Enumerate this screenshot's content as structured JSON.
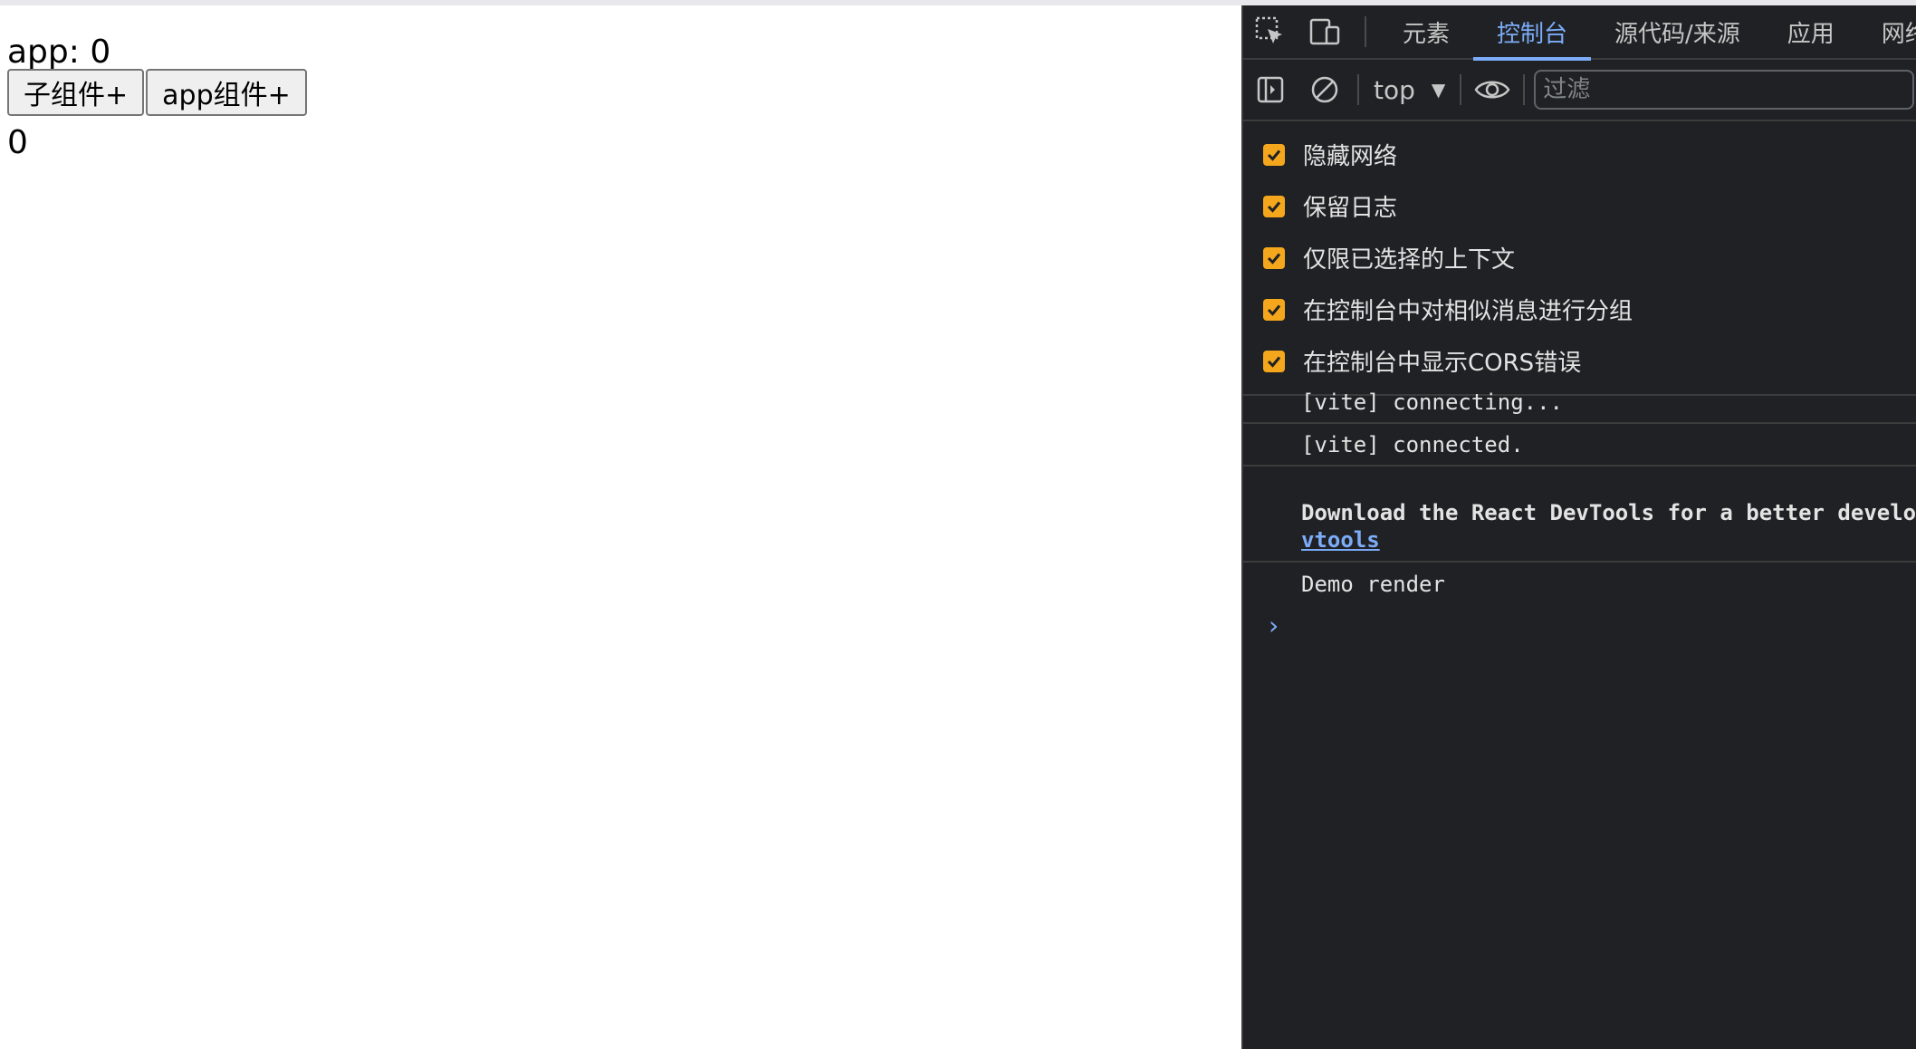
{
  "page": {
    "app_text": "app: 0",
    "buttons": {
      "child_add": "子组件+",
      "app_add": "app组件+"
    },
    "child_count": "0"
  },
  "devtools": {
    "tabs": [
      {
        "label": "元素",
        "active": false
      },
      {
        "label": "控制台",
        "active": true
      },
      {
        "label": "源代码/来源",
        "active": false
      },
      {
        "label": "应用",
        "active": false
      },
      {
        "label": "网络",
        "active": false
      }
    ],
    "toolbar": {
      "context": "top",
      "filter_placeholder": "过滤"
    },
    "settings": [
      {
        "label": "隐藏网络",
        "checked": true
      },
      {
        "label": "保留日志",
        "checked": true
      },
      {
        "label": "仅限已选择的上下文",
        "checked": true
      },
      {
        "label": "在控制台中对相似消息进行分组",
        "checked": true
      },
      {
        "label": "在控制台中显示CORS错误",
        "checked": true
      }
    ],
    "messages": {
      "m1": "[vite] connecting...",
      "m2": "[vite] connected.",
      "react_text": "Download the React DevTools for a better development experience: https://reactjs.org/link/react-de",
      "react_link": "vtools",
      "m4": "Demo render"
    },
    "colors": {
      "accent": "#7cacf8",
      "checkbox": "#f4a71c",
      "panel_bg": "#202124"
    }
  }
}
